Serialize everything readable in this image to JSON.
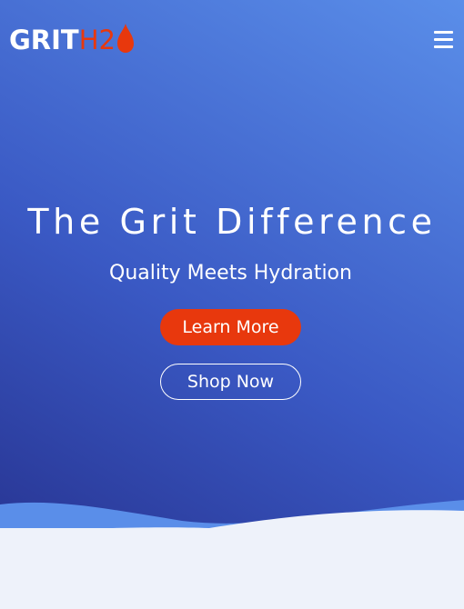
{
  "header": {
    "logo": {
      "grit": "GRIT",
      "h2": "H2"
    },
    "menu_icon": "hamburger-menu-icon"
  },
  "hero": {
    "title": "The Grit Difference",
    "subtitle": "Quality Meets Hydration",
    "learn_more_label": "Learn More",
    "shop_now_label": "Shop Now"
  },
  "colors": {
    "accent": "#e8380d",
    "hero_gradient_dark": "#283593",
    "hero_gradient_light": "#5a8ee9",
    "background": "#eef2fa",
    "text": "#ffffff"
  }
}
